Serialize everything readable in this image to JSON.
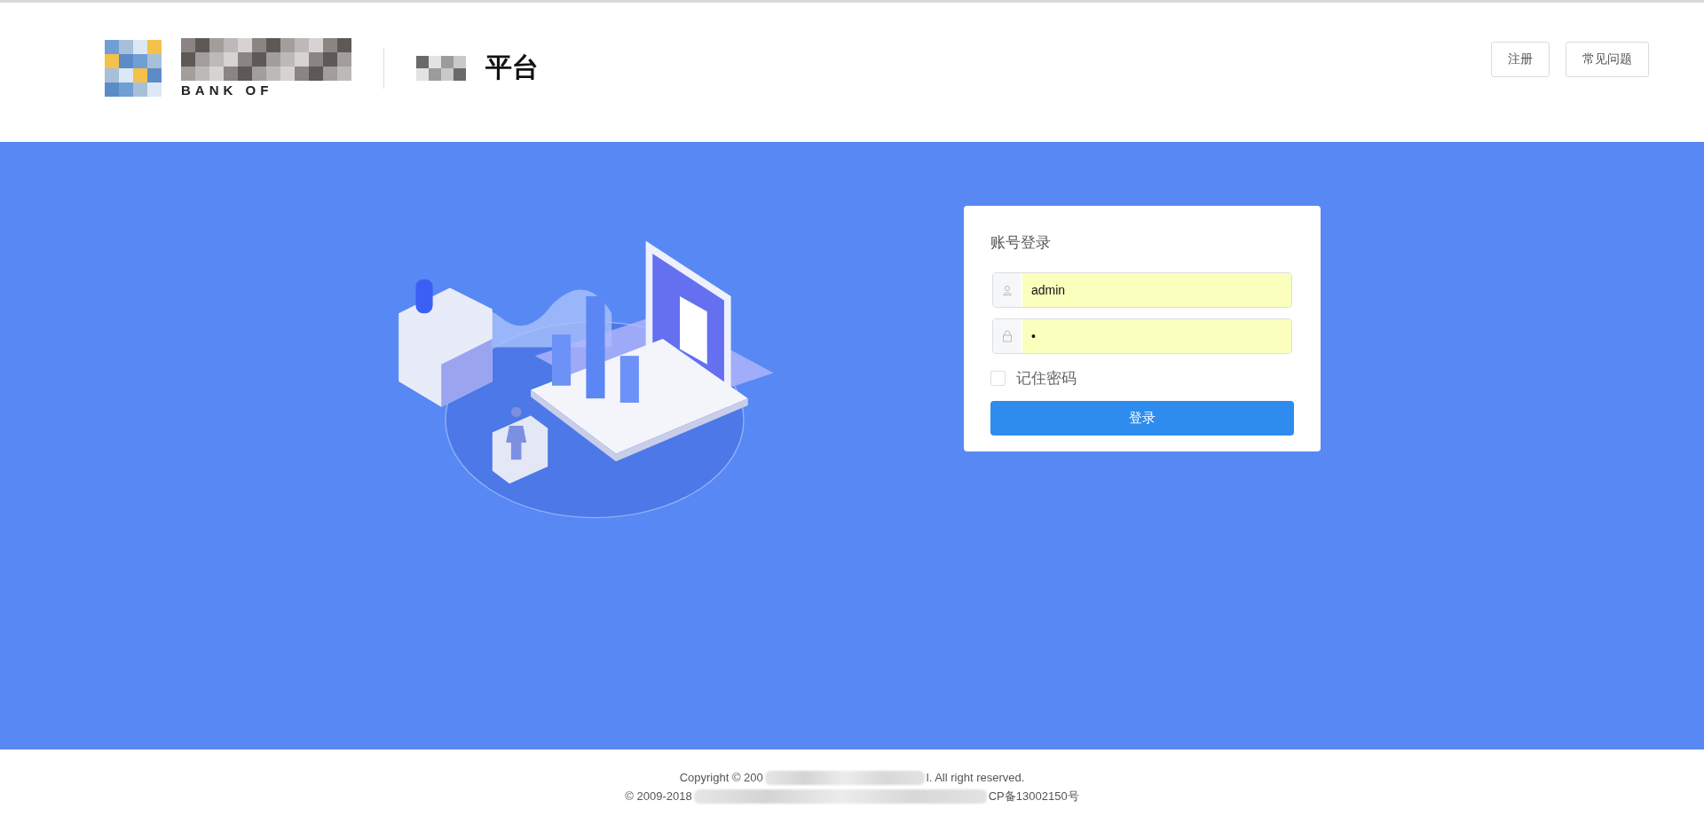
{
  "header": {
    "logo_caption": "BANK OF",
    "platform_suffix": "平台",
    "buttons": [
      {
        "label": "注册"
      },
      {
        "label": "常见问题"
      }
    ]
  },
  "login": {
    "title": "账号登录",
    "username": {
      "value": "admin"
    },
    "password": {
      "value": "•"
    },
    "remember": {
      "label": "记住密码",
      "checked": false
    },
    "submit": "登录"
  },
  "footer": {
    "lines": [
      [
        "Copyright © 200",
        "l. All right reserved."
      ],
      [
        "© 2009-2018",
        "CP备13002150号"
      ]
    ]
  }
}
